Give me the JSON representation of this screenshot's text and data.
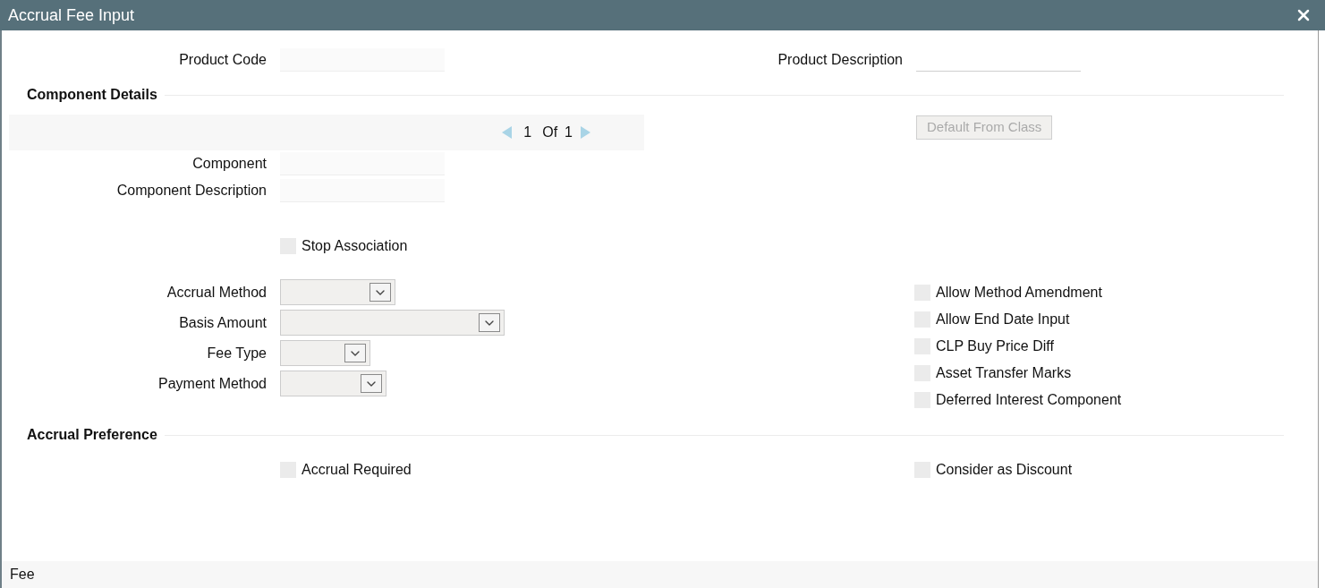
{
  "window": {
    "title": "Accrual Fee Input"
  },
  "product": {
    "fields": [
      {
        "label": "Product Code",
        "kind": "box"
      },
      {
        "label": "Product Description",
        "kind": "line"
      }
    ]
  },
  "component_details": {
    "title": "Component Details",
    "pager": {
      "current": "1",
      "of": "Of",
      "total": "1"
    },
    "default_button": {
      "label": "Default From Class",
      "disabled": true
    },
    "fields": [
      {
        "label": "Component"
      },
      {
        "label": "Component Description"
      }
    ],
    "stop_association": {
      "label": "Stop Association",
      "checked": false
    },
    "selects": [
      {
        "label": "Accrual Method"
      },
      {
        "label": "Basis Amount"
      },
      {
        "label": "Fee Type"
      },
      {
        "label": "Payment Method"
      }
    ],
    "options": [
      {
        "label": "Allow Method Amendment",
        "checked": false
      },
      {
        "label": "Allow End Date Input",
        "checked": false
      },
      {
        "label": "CLP Buy Price Diff",
        "checked": false
      },
      {
        "label": "Asset Transfer Marks",
        "checked": false
      },
      {
        "label": "Deferred Interest Component",
        "checked": false
      }
    ]
  },
  "accrual_preference": {
    "title": "Accrual Preference",
    "checkboxes": [
      {
        "label": "Accrual Required",
        "checked": false
      },
      {
        "label": "Consider as Discount",
        "checked": false
      }
    ]
  },
  "footer": {
    "label": "Fee"
  }
}
